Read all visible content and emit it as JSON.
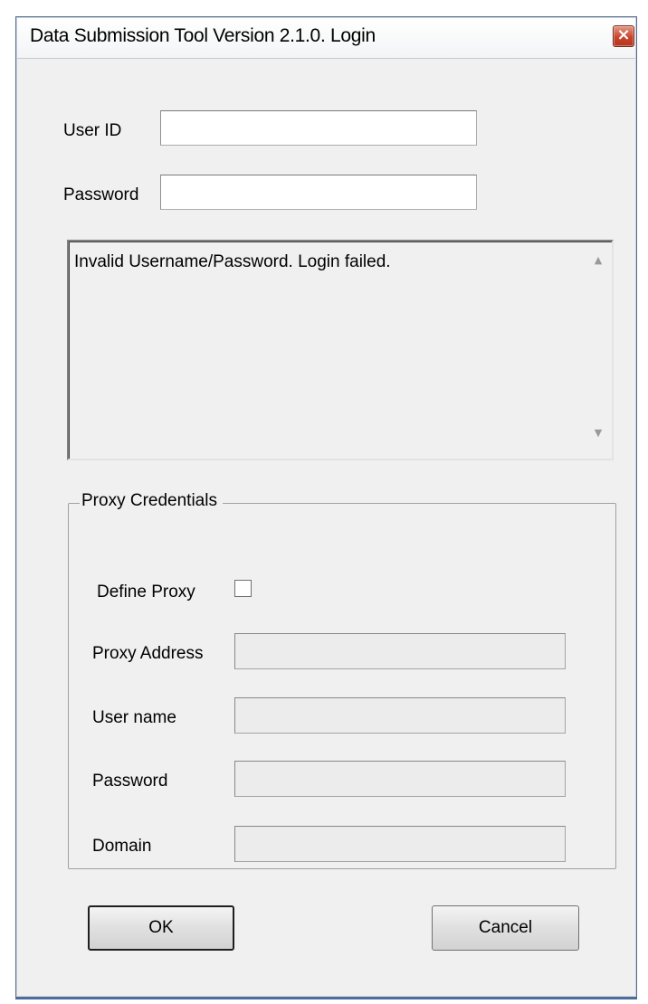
{
  "window": {
    "title": "Data Submission Tool Version  2.1.0. Login",
    "close_glyph": "×"
  },
  "login": {
    "user_id_label": "User ID",
    "user_id_value": "",
    "password_label": "Password",
    "password_value": ""
  },
  "message": {
    "text": "Invalid Username/Password. Login failed.",
    "scroll_up_icon": "▲",
    "scroll_down_icon": "▼"
  },
  "proxy": {
    "group_title": "Proxy Credentials",
    "define_proxy_label": "Define Proxy",
    "define_proxy_checked": false,
    "address_label": "Proxy Address",
    "address_value": "",
    "username_label": "User name",
    "username_value": "",
    "password_label": "Password",
    "password_value": "",
    "domain_label": "Domain",
    "domain_value": ""
  },
  "buttons": {
    "ok_label": "OK",
    "cancel_label": "Cancel"
  },
  "colors": {
    "dialog_background": "#f0f0f0",
    "close_button": "#c8452b",
    "frame_border": "#5b6b85"
  },
  "icons": {
    "close": "close-icon",
    "scroll_up": "scroll-up-arrow-icon",
    "scroll_down": "scroll-down-arrow-icon",
    "checkbox": "checkbox-icon"
  }
}
